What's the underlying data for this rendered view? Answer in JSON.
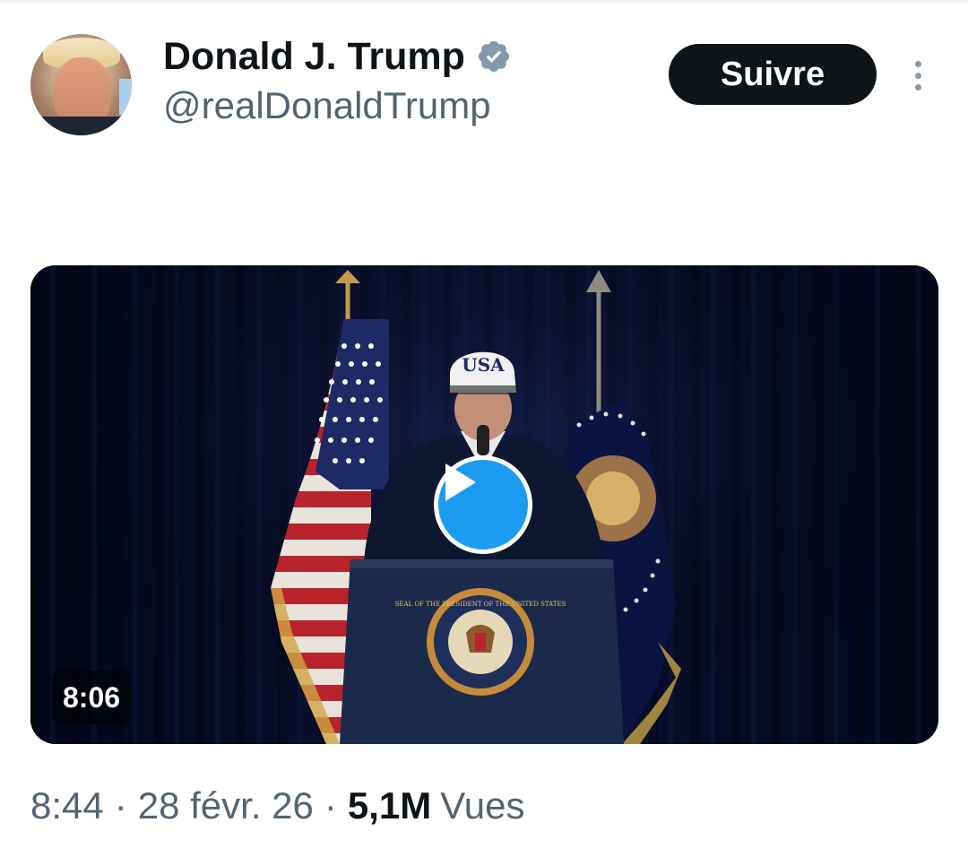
{
  "author": {
    "name": "Donald J. Trump",
    "handle": "@realDonaldTrump",
    "verified_color": "#829aab"
  },
  "actions": {
    "follow_label": "Suivre"
  },
  "media": {
    "duration": "8:06",
    "cap_text": "USA",
    "seal_text": "SEAL OF THE PRESIDENT OF THE UNITED STATES",
    "play_color": "#1d9bf0"
  },
  "meta": {
    "time": "8:44",
    "date": "28 févr. 26",
    "views_count": "5,1M",
    "views_label": "Vues"
  }
}
